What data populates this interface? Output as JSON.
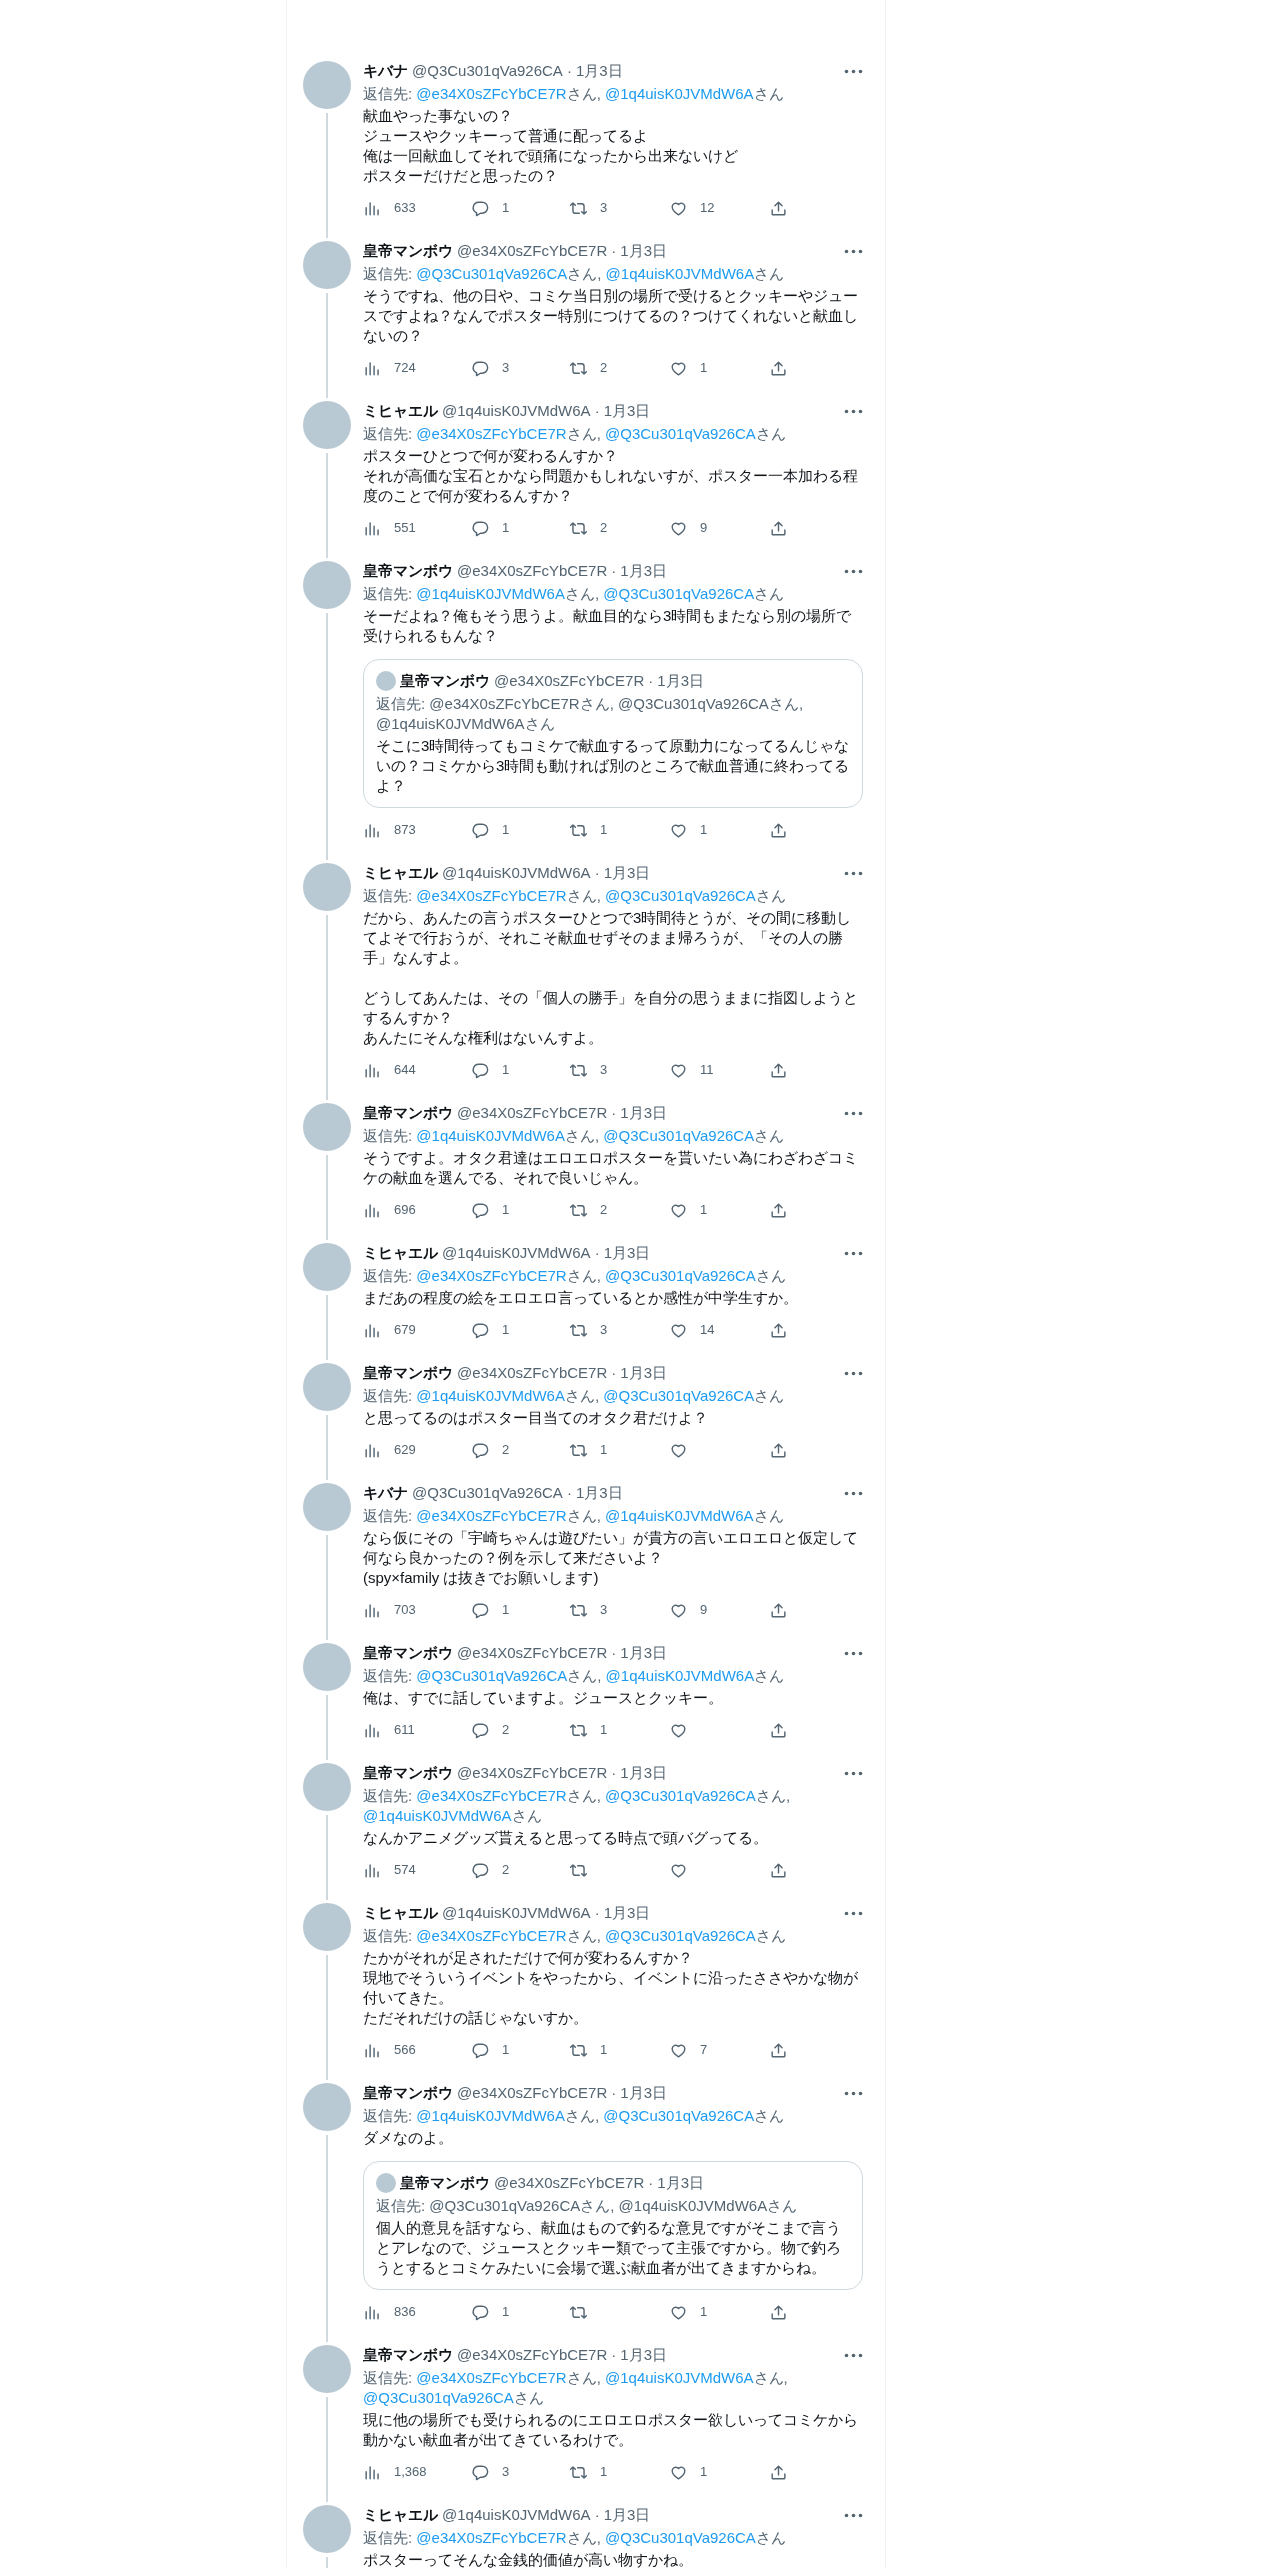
{
  "tweets": [
    {
      "name": "キバナ",
      "handle": "@Q3Cu301qVa926CA",
      "separator": "·",
      "date": "1月3日",
      "reply_to": {
        "label": "返信先:",
        "mentions": [
          {
            "handle": "@e34X0sZFcYbCE7R",
            "suffix": "さん,"
          },
          {
            "handle": "@1q4uisK0JVMdW6A",
            "suffix": "さん"
          }
        ]
      },
      "text": [
        [
          "献血やった事ないの？",
          "ジュースやクッキーって普通に配ってるよ",
          "俺は一回献血してそれで頭痛になったから出来ないけど",
          "ポスターだけだと思ったの？"
        ]
      ],
      "views": "633",
      "replies": "1",
      "retweets": "3",
      "likes": "12"
    },
    {
      "name": "皇帝マンボウ",
      "handle": "@e34X0sZFcYbCE7R",
      "separator": "·",
      "date": "1月3日",
      "reply_to": {
        "label": "返信先:",
        "mentions": [
          {
            "handle": "@Q3Cu301qVa926CA",
            "suffix": "さん,"
          },
          {
            "handle": "@1q4uisK0JVMdW6A",
            "suffix": "さん"
          }
        ]
      },
      "text": [
        [
          "そうですね、他の日や、コミケ当日別の場所で受けるとクッキーやジュースですよね？なんでポスター特別につけてるの？つけてくれないと献血しないの？"
        ]
      ],
      "views": "724",
      "replies": "3",
      "retweets": "2",
      "likes": "1"
    },
    {
      "name": "ミヒャエル",
      "handle": "@1q4uisK0JVMdW6A",
      "separator": "·",
      "date": "1月3日",
      "reply_to": {
        "label": "返信先:",
        "mentions": [
          {
            "handle": "@e34X0sZFcYbCE7R",
            "suffix": "さん,"
          },
          {
            "handle": "@Q3Cu301qVa926CA",
            "suffix": "さん"
          }
        ]
      },
      "text": [
        [
          "ポスターひとつで何が変わるんすか？",
          "それが高価な宝石とかなら問題かもしれないすが、ポスター一本加わる程度のことで何が変わるんすか？"
        ]
      ],
      "views": "551",
      "replies": "1",
      "retweets": "2",
      "likes": "9"
    },
    {
      "name": "皇帝マンボウ",
      "handle": "@e34X0sZFcYbCE7R",
      "separator": "·",
      "date": "1月3日",
      "reply_to": {
        "label": "返信先:",
        "mentions": [
          {
            "handle": "@1q4uisK0JVMdW6A",
            "suffix": "さん,"
          },
          {
            "handle": "@Q3Cu301qVa926CA",
            "suffix": "さん"
          }
        ]
      },
      "text": [
        [
          "そーだよね？俺もそう思うよ。献血目的なら3時間もまたなら別の場所で受けられるもんな？"
        ]
      ],
      "quote": {
        "name": "皇帝マンボウ",
        "handle": "@e34X0sZFcYbCE7R",
        "separator": "·",
        "date": "1月3日",
        "reply_to": {
          "label": "返信先:",
          "mentions": [
            {
              "handle": "@e34X0sZFcYbCE7R",
              "suffix": "さん,"
            },
            {
              "handle": "@Q3Cu301qVa926CA",
              "suffix": "さん,"
            },
            {
              "handle": "@1q4uisK0JVMdW6A",
              "suffix": "さん"
            }
          ]
        },
        "text": [
          [
            "そこに3時間待ってもコミケで献血するって原動力になってるんじゃないの？コミケから3時間も動ければ別のところで献血普通に終わってるよ？"
          ]
        ]
      },
      "views": "873",
      "replies": "1",
      "retweets": "1",
      "likes": "1"
    },
    {
      "name": "ミヒャエル",
      "handle": "@1q4uisK0JVMdW6A",
      "separator": "·",
      "date": "1月3日",
      "reply_to": {
        "label": "返信先:",
        "mentions": [
          {
            "handle": "@e34X0sZFcYbCE7R",
            "suffix": "さん,"
          },
          {
            "handle": "@Q3Cu301qVa926CA",
            "suffix": "さん"
          }
        ]
      },
      "text": [
        [
          "だから、あんたの言うポスターひとつで3時間待とうが、その間に移動してよそで行おうが、それこそ献血せずそのまま帰ろうが、「その人の勝手」なんすよ。"
        ],
        [
          "どうしてあんたは、その「個人の勝手」を自分の思うままに指図しようとするんすか？",
          "あんたにそんな権利はないんすよ。"
        ]
      ],
      "views": "644",
      "replies": "1",
      "retweets": "3",
      "likes": "11"
    },
    {
      "name": "皇帝マンボウ",
      "handle": "@e34X0sZFcYbCE7R",
      "separator": "·",
      "date": "1月3日",
      "reply_to": {
        "label": "返信先:",
        "mentions": [
          {
            "handle": "@1q4uisK0JVMdW6A",
            "suffix": "さん,"
          },
          {
            "handle": "@Q3Cu301qVa926CA",
            "suffix": "さん"
          }
        ]
      },
      "text": [
        [
          "そうですよ。オタク君達はエロエロポスターを貰いたい為にわざわざコミケの献血を選んでる、それで良いじゃん。"
        ]
      ],
      "views": "696",
      "replies": "1",
      "retweets": "2",
      "likes": "1"
    },
    {
      "name": "ミヒャエル",
      "handle": "@1q4uisK0JVMdW6A",
      "separator": "·",
      "date": "1月3日",
      "reply_to": {
        "label": "返信先:",
        "mentions": [
          {
            "handle": "@e34X0sZFcYbCE7R",
            "suffix": "さん,"
          },
          {
            "handle": "@Q3Cu301qVa926CA",
            "suffix": "さん"
          }
        ]
      },
      "text": [
        [
          "まだあの程度の絵をエロエロ言っているとか感性が中学生すか。"
        ]
      ],
      "views": "679",
      "replies": "1",
      "retweets": "3",
      "likes": "14"
    },
    {
      "name": "皇帝マンボウ",
      "handle": "@e34X0sZFcYbCE7R",
      "separator": "·",
      "date": "1月3日",
      "reply_to": {
        "label": "返信先:",
        "mentions": [
          {
            "handle": "@1q4uisK0JVMdW6A",
            "suffix": "さん,"
          },
          {
            "handle": "@Q3Cu301qVa926CA",
            "suffix": "さん"
          }
        ]
      },
      "text": [
        [
          "と思ってるのはポスター目当てのオタク君だけよ？"
        ]
      ],
      "views": "629",
      "replies": "2",
      "retweets": "1"
    },
    {
      "name": "キバナ",
      "handle": "@Q3Cu301qVa926CA",
      "separator": "·",
      "date": "1月3日",
      "reply_to": {
        "label": "返信先:",
        "mentions": [
          {
            "handle": "@e34X0sZFcYbCE7R",
            "suffix": "さん,"
          },
          {
            "handle": "@1q4uisK0JVMdW6A",
            "suffix": "さん"
          }
        ]
      },
      "text": [
        [
          "なら仮にその「宇崎ちゃんは遊びたい」が貴方の言いエロエロと仮定して何なら良かったの？例を示して来ださいよ？",
          "(spy×family は抜きでお願いします)"
        ]
      ],
      "views": "703",
      "replies": "1",
      "retweets": "3",
      "likes": "9"
    },
    {
      "name": "皇帝マンボウ",
      "handle": "@e34X0sZFcYbCE7R",
      "separator": "·",
      "date": "1月3日",
      "reply_to": {
        "label": "返信先:",
        "mentions": [
          {
            "handle": "@Q3Cu301qVa926CA",
            "suffix": "さん,"
          },
          {
            "handle": "@1q4uisK0JVMdW6A",
            "suffix": "さん"
          }
        ]
      },
      "text": [
        [
          "俺は、すでに話していますよ。ジュースとクッキー。"
        ]
      ],
      "views": "611",
      "replies": "2",
      "retweets": "1"
    },
    {
      "name": "皇帝マンボウ",
      "handle": "@e34X0sZFcYbCE7R",
      "separator": "·",
      "date": "1月3日",
      "reply_to": {
        "label": "返信先:",
        "mentions": [
          {
            "handle": "@e34X0sZFcYbCE7R",
            "suffix": "さん,"
          },
          {
            "handle": "@Q3Cu301qVa926CA",
            "suffix": "さん,"
          },
          {
            "handle": "@1q4uisK0JVMdW6A",
            "suffix": "さん"
          }
        ]
      },
      "text": [
        [
          "なんかアニメグッズ貰えると思ってる時点で頭バグってる。"
        ]
      ],
      "views": "574",
      "replies": "2"
    },
    {
      "name": "ミヒャエル",
      "handle": "@1q4uisK0JVMdW6A",
      "separator": "·",
      "date": "1月3日",
      "reply_to": {
        "label": "返信先:",
        "mentions": [
          {
            "handle": "@e34X0sZFcYbCE7R",
            "suffix": "さん,"
          },
          {
            "handle": "@Q3Cu301qVa926CA",
            "suffix": "さん"
          }
        ]
      },
      "text": [
        [
          "たかがそれが足されただけで何が変わるんすか？",
          "現地でそういうイベントをやったから、イベントに沿ったささやかな物が付いてきた。",
          "ただそれだけの話じゃないすか。"
        ]
      ],
      "views": "566",
      "replies": "1",
      "retweets": "1",
      "likes": "7"
    },
    {
      "name": "皇帝マンボウ",
      "handle": "@e34X0sZFcYbCE7R",
      "separator": "·",
      "date": "1月3日",
      "reply_to": {
        "label": "返信先:",
        "mentions": [
          {
            "handle": "@1q4uisK0JVMdW6A",
            "suffix": "さん,"
          },
          {
            "handle": "@Q3Cu301qVa926CA",
            "suffix": "さん"
          }
        ]
      },
      "text": [
        [
          "ダメなのよ。"
        ]
      ],
      "quote": {
        "name": "皇帝マンボウ",
        "handle": "@e34X0sZFcYbCE7R",
        "separator": "·",
        "date": "1月3日",
        "reply_to": {
          "label": "返信先:",
          "mentions": [
            {
              "handle": "@Q3Cu301qVa926CA",
              "suffix": "さん,"
            },
            {
              "handle": "@1q4uisK0JVMdW6A",
              "suffix": "さん"
            }
          ]
        },
        "text": [
          [
            "個人的意見を話すなら、献血はもので釣るな意見ですがそこまで言うとアレなので、ジュースとクッキー類でって主張ですから。物で釣ろうとするとコミケみたいに会場で選ぶ献血者が出てきますからね。"
          ]
        ]
      },
      "views": "836",
      "replies": "1",
      "likes": "1"
    },
    {
      "name": "皇帝マンボウ",
      "handle": "@e34X0sZFcYbCE7R",
      "separator": "·",
      "date": "1月3日",
      "reply_to": {
        "label": "返信先:",
        "mentions": [
          {
            "handle": "@e34X0sZFcYbCE7R",
            "suffix": "さん,"
          },
          {
            "handle": "@1q4uisK0JVMdW6A",
            "suffix": "さん,"
          },
          {
            "handle": "@Q3Cu301qVa926CA",
            "suffix": "さん"
          }
        ]
      },
      "text": [
        [
          "現に他の場所でも受けられるのにエロエロポスター欲しいってコミケから動かない献血者が出てきているわけで。"
        ]
      ],
      "views": "1,368",
      "replies": "3",
      "retweets": "1",
      "likes": "1"
    },
    {
      "name": "ミヒャエル",
      "handle": "@1q4uisK0JVMdW6A",
      "separator": "·",
      "date": "1月3日",
      "reply_to": {
        "label": "返信先:",
        "mentions": [
          {
            "handle": "@e34X0sZFcYbCE7R",
            "suffix": "さん,"
          },
          {
            "handle": "@Q3Cu301qVa926CA",
            "suffix": "さん"
          }
        ]
      },
      "text": [
        [
          "ポスターってそんな金銭的価値が高い物すかね。"
        ]
      ]
    }
  ]
}
